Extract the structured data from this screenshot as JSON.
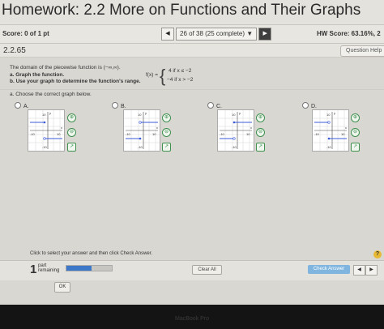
{
  "header": {
    "title": "Homework: 2.2 More on Functions and Their Graphs"
  },
  "score_bar": {
    "score": "Score: 0 of 1 pt",
    "question_counter": "26 of 38 (25 complete)",
    "hw_score": "HW Score: 63.16%, 2"
  },
  "question": {
    "number": "2.2.65",
    "help_label": "Question Help"
  },
  "problem": {
    "intro": "The domain of the piecewise function is (−∞,∞).",
    "part_a": "a. Graph the function.",
    "part_b": "b. Use your graph to determine the function's range.",
    "function_name": "f(x) =",
    "brace": "{",
    "case1": "4   if  x ≤ −2",
    "case2": "−4   if  x > −2"
  },
  "part_a_prompt": "a. Choose the correct graph below.",
  "options": [
    {
      "label": "A.",
      "selected": false
    },
    {
      "label": "B.",
      "selected": false
    },
    {
      "label": "C.",
      "selected": false
    },
    {
      "label": "D.",
      "selected": false
    }
  ],
  "graph_ticks": {
    "top": "10",
    "left": "-10",
    "right": "10",
    "bottom": "-10",
    "y_axis": "y",
    "x_axis": "x"
  },
  "footer": {
    "instruction": "Click to select your answer and then click Check Answer.",
    "parts_count": "1",
    "parts_label_1": "part",
    "parts_label_2": "remaining",
    "progress": 0.55,
    "clear_all": "Clear All",
    "check_answer": "Check Answer",
    "prev": "◀",
    "next": "▶",
    "ok": "OK",
    "info_icon_text": "?"
  },
  "icons": {
    "nav_prev": "◀",
    "nav_next": "▶",
    "zoom_in": "⊕",
    "zoom_out": "⊖",
    "external": "↗"
  },
  "colors": {
    "graph_line": "#3a5ad9",
    "accent_green": "#3f8f4f",
    "check_button": "#7fb5de",
    "info_yellow": "#e7b935"
  },
  "laptop_label": "MacBook Pro"
}
